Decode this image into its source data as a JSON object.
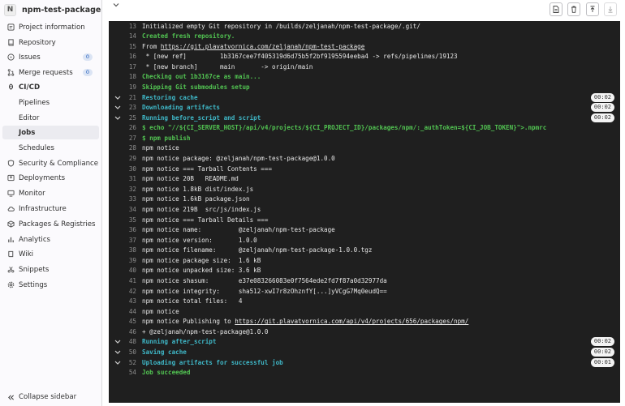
{
  "sidebar": {
    "avatar_letter": "N",
    "project_name": "npm-test-package",
    "items": [
      {
        "label": "Project information",
        "icon": "project-icon"
      },
      {
        "label": "Repository",
        "icon": "repository-icon"
      },
      {
        "label": "Issues",
        "icon": "issues-icon",
        "badge": "0"
      },
      {
        "label": "Merge requests",
        "icon": "merge-request-icon",
        "badge": "0"
      },
      {
        "label": "CI/CD",
        "icon": "rocket-icon"
      },
      {
        "label": "Pipelines"
      },
      {
        "label": "Editor"
      },
      {
        "label": "Jobs"
      },
      {
        "label": "Schedules"
      },
      {
        "label": "Security & Compliance",
        "icon": "shield-icon"
      },
      {
        "label": "Deployments",
        "icon": "deployments-icon"
      },
      {
        "label": "Monitor",
        "icon": "monitor-icon"
      },
      {
        "label": "Infrastructure",
        "icon": "cloud-icon"
      },
      {
        "label": "Packages & Registries",
        "icon": "package-icon"
      },
      {
        "label": "Analytics",
        "icon": "chart-icon"
      },
      {
        "label": "Wiki",
        "icon": "book-icon"
      },
      {
        "label": "Snippets",
        "icon": "snippet-icon"
      },
      {
        "label": "Settings",
        "icon": "gear-icon"
      }
    ],
    "collapse_label": "Collapse sidebar"
  },
  "toolbar": {
    "buttons": [
      "raw-log-icon",
      "erase-log-icon",
      "scroll-top-icon",
      "scroll-bottom-icon"
    ]
  },
  "log": {
    "lines": [
      {
        "n": "13",
        "text": "Initialized empty Git repository in /builds/zeljanah/npm-test-package/.git/"
      },
      {
        "n": "14",
        "text": "Created fresh repository.",
        "style": "green"
      },
      {
        "n": "15",
        "pre": "From ",
        "link": "https://git.plavatvornica.com/zeljanah/npm-test-package",
        "post": ""
      },
      {
        "n": "16",
        "text": " * [new ref]         1b3167cee7f405319d6d75b5f2bf9195594eeba4 -> refs/pipelines/19123"
      },
      {
        "n": "17",
        "text": " * [new branch]      main       -> origin/main"
      },
      {
        "n": "18",
        "text": "Checking out 1b3167ce as main...",
        "style": "green"
      },
      {
        "n": "19",
        "text": "Skipping Git submodules setup",
        "style": "green"
      },
      {
        "n": "21",
        "text": "Restoring cache",
        "style": "cyan",
        "section": true,
        "dur": "00:02"
      },
      {
        "n": "23",
        "text": "Downloading artifacts",
        "style": "cyan",
        "section": true,
        "dur": "00:02"
      },
      {
        "n": "25",
        "text": "Running before_script and script",
        "style": "cyan",
        "section": true,
        "dur": "00:02"
      },
      {
        "n": "26",
        "text": "$ echo \"//${CI_SERVER_HOST}/api/v4/projects/${CI_PROJECT_ID}/packages/npm/:_authToken=${CI_JOB_TOKEN}\">.npmrc",
        "style": "green"
      },
      {
        "n": "27",
        "text": "$ npm publish",
        "style": "green"
      },
      {
        "n": "28",
        "text": "npm notice"
      },
      {
        "n": "29",
        "text": "npm notice package: @zeljanah/npm-test-package@1.0.0"
      },
      {
        "n": "30",
        "text": "npm notice === Tarball Contents ==="
      },
      {
        "n": "31",
        "text": "npm notice 20B   README.md"
      },
      {
        "n": "32",
        "text": "npm notice 1.8kB dist/index.js"
      },
      {
        "n": "33",
        "text": "npm notice 1.6kB package.json"
      },
      {
        "n": "34",
        "text": "npm notice 219B  src/js/index.js"
      },
      {
        "n": "35",
        "text": "npm notice === Tarball Details ==="
      },
      {
        "n": "36",
        "text": "npm notice name:          @zeljanah/npm-test-package"
      },
      {
        "n": "37",
        "text": "npm notice version:       1.0.0"
      },
      {
        "n": "38",
        "text": "npm notice filename:      @zeljanah/npm-test-package-1.0.0.tgz"
      },
      {
        "n": "39",
        "text": "npm notice package size:  1.6 kB"
      },
      {
        "n": "40",
        "text": "npm notice unpacked size: 3.6 kB"
      },
      {
        "n": "41",
        "text": "npm notice shasum:        e37e083266083e0f7564ede2fd7f87a0d32977da"
      },
      {
        "n": "42",
        "text": "npm notice integrity:     sha512-xwI7r8zOhznfY[...]yVCgG7Mq0eudQ=="
      },
      {
        "n": "43",
        "text": "npm notice total files:   4"
      },
      {
        "n": "44",
        "text": "npm notice"
      },
      {
        "n": "45",
        "pre": "npm notice Publishing to ",
        "link": "https://git.plavatvornica.com/api/v4/projects/656/packages/npm/",
        "post": ""
      },
      {
        "n": "46",
        "text": "+ @zeljanah/npm-test-package@1.0.0"
      },
      {
        "n": "48",
        "text": "Running after_script",
        "style": "cyan",
        "section": true,
        "dur": "00:02"
      },
      {
        "n": "50",
        "text": "Saving cache",
        "style": "cyan",
        "section": true,
        "dur": "00:02"
      },
      {
        "n": "52",
        "text": "Uploading artifacts for successful job",
        "style": "cyan",
        "section": true,
        "dur": "00:01"
      },
      {
        "n": "54",
        "text": "Job succeeded",
        "style": "green"
      }
    ]
  }
}
